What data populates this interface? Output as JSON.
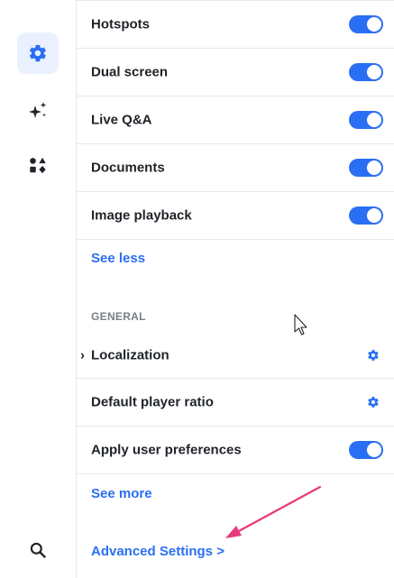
{
  "sidebar": {
    "items": [
      {
        "name": "settings",
        "icon": "gear-icon",
        "active": true
      },
      {
        "name": "ai",
        "icon": "sparkles-icon",
        "active": false
      },
      {
        "name": "apps",
        "icon": "shapes-icon",
        "active": false
      }
    ],
    "bottom": {
      "icon": "search-icon"
    }
  },
  "features": [
    {
      "label": "Hotspots",
      "enabled": true
    },
    {
      "label": "Dual screen",
      "enabled": true
    },
    {
      "label": "Live Q&A",
      "enabled": true
    },
    {
      "label": "Documents",
      "enabled": true
    },
    {
      "label": "Image playback",
      "enabled": true
    }
  ],
  "see_less": "See less",
  "general": {
    "title": "GENERAL",
    "localization": "Localization",
    "default_player_ratio": "Default player ratio",
    "apply_user_preferences": "Apply user preferences",
    "apply_user_preferences_enabled": true
  },
  "see_more": "See more",
  "advanced_settings": "Advanced Settings >",
  "colors": {
    "accent": "#2a6ff3",
    "arrow": "#e8397a",
    "active_bg": "#eaf0fe"
  }
}
